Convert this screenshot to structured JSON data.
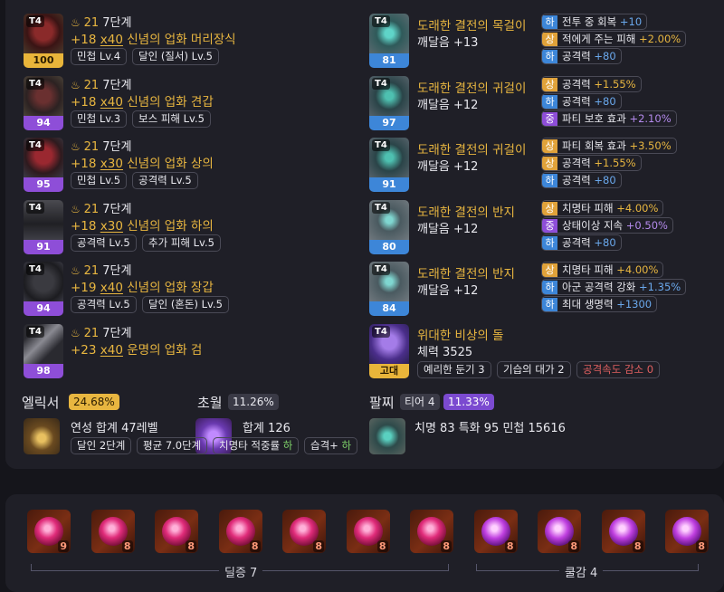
{
  "armor": [
    {
      "name": "helmet",
      "tier": "T4",
      "quality": "100",
      "qcolor": "gold",
      "level": "21",
      "stage": "7단계",
      "plus": "+18",
      "mult": "x40",
      "title": "신념의 업화 머리장식",
      "tags": [
        "민첩 Lv.4",
        "달인 (질서) Lv.5"
      ]
    },
    {
      "name": "shoulder",
      "tier": "T4",
      "quality": "94",
      "qcolor": "purple",
      "level": "21",
      "stage": "7단계",
      "plus": "+18",
      "mult": "x40",
      "title": "신념의 업화 견갑",
      "tags": [
        "민첩 Lv.3",
        "보스 피해 Lv.5"
      ]
    },
    {
      "name": "chest",
      "tier": "T4",
      "quality": "95",
      "qcolor": "purple",
      "level": "21",
      "stage": "7단계",
      "plus": "+18",
      "mult": "x30",
      "title": "신념의 업화 상의",
      "tags": [
        "민첩 Lv.5",
        "공격력 Lv.5"
      ]
    },
    {
      "name": "legs",
      "tier": "T4",
      "quality": "91",
      "qcolor": "purple",
      "level": "21",
      "stage": "7단계",
      "plus": "+18",
      "mult": "x30",
      "title": "신념의 업화 하의",
      "tags": [
        "공격력 Lv.5",
        "추가 피해 Lv.5"
      ]
    },
    {
      "name": "gloves",
      "tier": "T4",
      "quality": "94",
      "qcolor": "purple",
      "level": "21",
      "stage": "7단계",
      "plus": "+19",
      "mult": "x40",
      "title": "신념의 업화 장갑",
      "tags": [
        "공격력 Lv.5",
        "달인 (혼돈) Lv.5"
      ]
    },
    {
      "name": "weapon",
      "tier": "T4",
      "quality": "98",
      "qcolor": "purple",
      "level": "21",
      "stage": "7단계",
      "plus": "+23",
      "mult": "x40",
      "title": "운명의 업화 검",
      "tags": []
    }
  ],
  "accessories": [
    {
      "name": "necklace",
      "tier": "T4",
      "quality": "81",
      "title": "도래한 결전의 목걸이",
      "sub": "깨달음 +13",
      "opts": [
        {
          "g": "하",
          "t": "전투 중 회복",
          "v": "+10",
          "c": "blue"
        },
        {
          "g": "상",
          "t": "적에게 주는 피해",
          "v": "+2.00%",
          "c": "gold"
        },
        {
          "g": "하",
          "t": "공격력",
          "v": "+80",
          "c": "blue"
        }
      ]
    },
    {
      "name": "earring1",
      "tier": "T4",
      "quality": "97",
      "title": "도래한 결전의 귀걸이",
      "sub": "깨달음 +12",
      "opts": [
        {
          "g": "상",
          "t": "공격력",
          "v": "+1.55%",
          "c": "gold"
        },
        {
          "g": "하",
          "t": "공격력",
          "v": "+80",
          "c": "blue"
        },
        {
          "g": "중",
          "t": "파티 보호 효과",
          "v": "+2.10%",
          "c": "purple"
        }
      ]
    },
    {
      "name": "earring2",
      "tier": "T4",
      "quality": "91",
      "title": "도래한 결전의 귀걸이",
      "sub": "깨달음 +12",
      "opts": [
        {
          "g": "상",
          "t": "파티 회복 효과",
          "v": "+3.50%",
          "c": "gold"
        },
        {
          "g": "상",
          "t": "공격력",
          "v": "+1.55%",
          "c": "gold"
        },
        {
          "g": "하",
          "t": "공격력",
          "v": "+80",
          "c": "blue"
        }
      ]
    },
    {
      "name": "ring1",
      "tier": "T4",
      "quality": "80",
      "title": "도래한 결전의 반지",
      "sub": "깨달음 +12",
      "opts": [
        {
          "g": "상",
          "t": "치명타 피해",
          "v": "+4.00%",
          "c": "gold"
        },
        {
          "g": "중",
          "t": "상태이상 지속",
          "v": "+0.50%",
          "c": "purple"
        },
        {
          "g": "하",
          "t": "공격력",
          "v": "+80",
          "c": "blue"
        }
      ]
    },
    {
      "name": "ring2",
      "tier": "T4",
      "quality": "84",
      "title": "도래한 결전의 반지",
      "sub": "깨달음 +12",
      "opts": [
        {
          "g": "상",
          "t": "치명타 피해",
          "v": "+4.00%",
          "c": "gold"
        },
        {
          "g": "하",
          "t": "아군 공격력 강화",
          "v": "+1.35%",
          "c": "blue"
        },
        {
          "g": "하",
          "t": "최대 생명력",
          "v": "+1300",
          "c": "blue"
        }
      ]
    }
  ],
  "stone": {
    "tier": "T4",
    "grade": "고대",
    "title": "위대한 비상의 돌",
    "sub": "체력 3525",
    "engr": [
      {
        "t": "예리한 둔기",
        "v": "3"
      },
      {
        "t": "기습의 대가",
        "v": "2"
      },
      {
        "t": "공격속도 감소",
        "v": "0"
      }
    ]
  },
  "elixir": {
    "label": "엘릭서",
    "pct": "24.68%",
    "line1": "연성 합계 47레벨",
    "tag": "달인 2단계"
  },
  "transcend": {
    "label": "초월",
    "pct": "11.26%",
    "line1": "합계 126",
    "tag": "평균 7.0단계"
  },
  "bracelet": {
    "label": "팔찌",
    "tier": "티어 4",
    "pct": "11.33%",
    "line1": "치명 83  특화 95  민첩 15616",
    "tags": [
      {
        "t": "치명타 적중률",
        "v": "하"
      },
      {
        "t": "습격+",
        "v": "하"
      }
    ]
  },
  "gems": [
    {
      "lv": "9",
      "type": "red"
    },
    {
      "lv": "8",
      "type": "red"
    },
    {
      "lv": "8",
      "type": "red"
    },
    {
      "lv": "8",
      "type": "red"
    },
    {
      "lv": "8",
      "type": "red"
    },
    {
      "lv": "8",
      "type": "red"
    },
    {
      "lv": "8",
      "type": "red"
    },
    {
      "lv": "8",
      "type": "purple"
    },
    {
      "lv": "8",
      "type": "purple"
    },
    {
      "lv": "8",
      "type": "purple"
    },
    {
      "lv": "8",
      "type": "purple"
    }
  ],
  "gem_groups": [
    {
      "label": "딜증 7"
    },
    {
      "label": "쿨감 4"
    }
  ]
}
